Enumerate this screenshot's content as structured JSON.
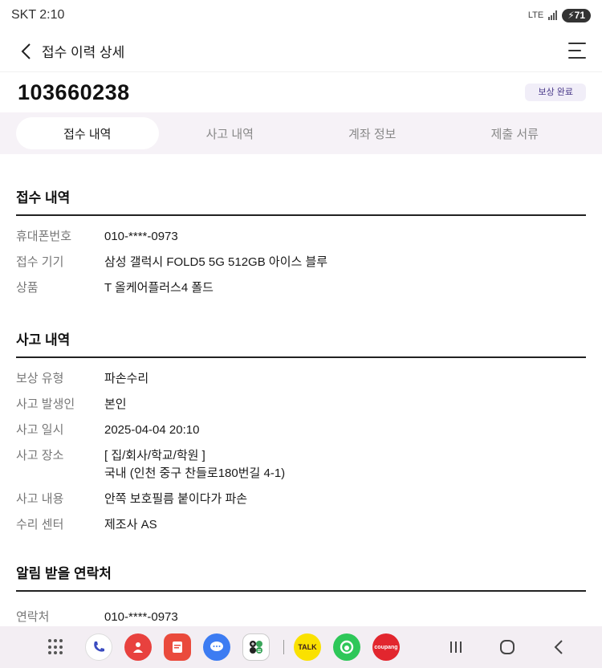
{
  "status_bar": {
    "carrier_time": "SKT 2:10",
    "network": "LTE",
    "battery": "71"
  },
  "header": {
    "title": "접수 이력 상세"
  },
  "claim": {
    "number": "103660238",
    "status": "보상 완료"
  },
  "tabs": [
    {
      "label": "접수 내역",
      "active": true
    },
    {
      "label": "사고 내역",
      "active": false
    },
    {
      "label": "계좌 정보",
      "active": false
    },
    {
      "label": "제출 서류",
      "active": false
    }
  ],
  "sections": {
    "receipt": {
      "title": "접수 내역",
      "rows": [
        {
          "label": "휴대폰번호",
          "value": "010-****-0973"
        },
        {
          "label": "접수 기기",
          "value": "삼성 갤럭시 FOLD5 5G 512GB 아이스 블루"
        },
        {
          "label": "상품",
          "value": "T 올케어플러스4 폴드"
        }
      ]
    },
    "accident": {
      "title": "사고 내역",
      "rows": [
        {
          "label": "보상 유형",
          "value": "파손수리"
        },
        {
          "label": "사고 발생인",
          "value": "본인"
        },
        {
          "label": "사고 일시",
          "value": "2025-04-04 20:10"
        },
        {
          "label": "사고 장소",
          "value": "[ 집/회사/학교/학원 ]",
          "value2": "국내 (인천 중구 찬들로180번길 4-1)"
        },
        {
          "label": "사고 내용",
          "value": "안쪽 보호필름 붙이다가 파손"
        },
        {
          "label": "수리 센터",
          "value": "제조사 AS"
        }
      ]
    },
    "contact": {
      "title": "알림 받을 연락처",
      "rows": [
        {
          "label": "연락처",
          "value": "010-****-0973"
        }
      ]
    }
  },
  "nav": {
    "apps": [
      "phone-app",
      "contacts-app",
      "notes-app",
      "messages-app",
      "calculator-app",
      "kakaotalk-app",
      "band-app",
      "coupang-app"
    ],
    "kakaotalk_label": "TALK",
    "coupang_label": "coupang"
  },
  "colors": {
    "accent": "#4a3a8a",
    "tab_bg": "#f6f2f7",
    "badge_bg": "#f1eef8"
  }
}
